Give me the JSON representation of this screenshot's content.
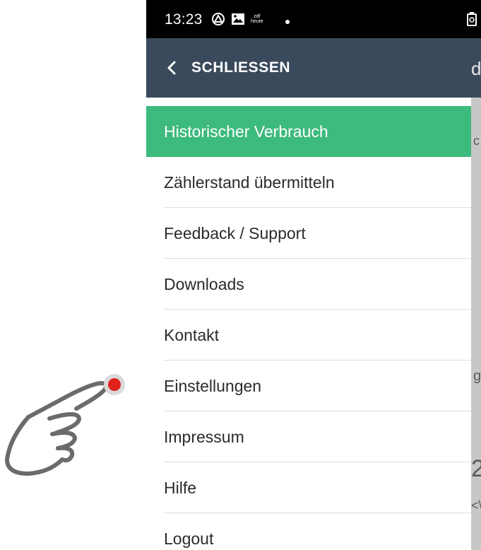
{
  "status_bar": {
    "time": "13:23",
    "icons": [
      "triangle-drive-icon",
      "image-icon",
      "zdf-heute-icon",
      "notification-dot",
      "battery-icon"
    ],
    "zdf_text_top": "zdf",
    "zdf_text_bottom": "heute"
  },
  "drawer": {
    "close_label": "SCHLIESSEN",
    "items": [
      {
        "label": "Historischer Verbrauch",
        "active": true
      },
      {
        "label": "Zählerstand übermitteln"
      },
      {
        "label": "Feedback / Support"
      },
      {
        "label": "Downloads"
      },
      {
        "label": "Kontakt"
      },
      {
        "label": "Einstellungen"
      },
      {
        "label": "Impressum"
      },
      {
        "label": "Hilfe"
      },
      {
        "label": "Logout"
      }
    ]
  },
  "background_fragments": {
    "header_char": "d",
    "frag1": "c",
    "frag2": "g",
    "frag3": "2",
    "frag4": "<\\"
  },
  "colors": {
    "header": "#3a4a5c",
    "active": "#3dba7d",
    "gesture_dot": "#e0201b"
  }
}
